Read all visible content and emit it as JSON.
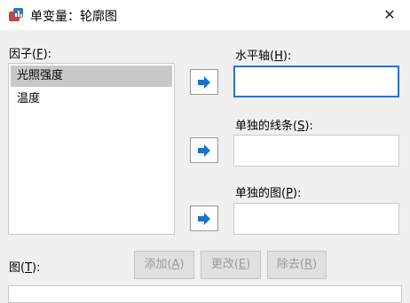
{
  "window": {
    "title": "单变量：轮廓图",
    "close_glyph": "✕"
  },
  "factors": {
    "label_prefix": "因子(",
    "label_key": "F",
    "label_suffix": "):",
    "items": [
      "光照强度",
      "温度"
    ],
    "selected_index": 0
  },
  "horizontal_axis": {
    "label_prefix": "水平轴(",
    "label_key": "H",
    "label_suffix": "):",
    "value": ""
  },
  "separate_lines": {
    "label_prefix": "单独的线条(",
    "label_key": "S",
    "label_suffix": "):",
    "value": ""
  },
  "separate_plots": {
    "label_prefix": "单独的图(",
    "label_key": "P",
    "label_suffix": "):",
    "value": ""
  },
  "plots": {
    "label_prefix": "图(",
    "label_key": "T",
    "label_suffix": "):",
    "add_prefix": "添加(",
    "add_key": "A",
    "add_suffix": ")",
    "change_prefix": "更改(",
    "change_key": "E",
    "change_suffix": ")",
    "remove_prefix": "除去(",
    "remove_key": "R",
    "remove_suffix": ")"
  },
  "colors": {
    "accent": "#2f6fd0",
    "arrow": "#1a73c8"
  },
  "icons": {
    "app": "spss-chart-icon",
    "move": "move-right-arrow-icon"
  }
}
